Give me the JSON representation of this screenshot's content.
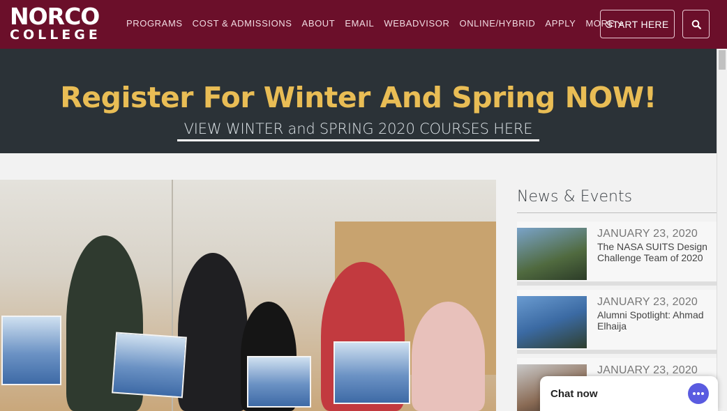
{
  "logo": {
    "line1": "NORCO",
    "line2": "COLLEGE"
  },
  "nav": {
    "items": [
      "PROGRAMS",
      "COST & ADMISSIONS",
      "ABOUT",
      "EMAIL",
      "WEBADVISOR",
      "ONLINE/HYBRID",
      "APPLY"
    ],
    "more_label": "MORE",
    "start_label": "START HERE"
  },
  "banner": {
    "title": "Register For Winter And Spring NOW!",
    "link": "VIEW WINTER and SPRING 2020 COURSES HERE"
  },
  "news": {
    "title": "News & Events",
    "items": [
      {
        "date": "JANUARY 23, 2020",
        "text": "The NASA SUITS Design Challenge Team of 2020"
      },
      {
        "date": "JANUARY 23, 2020",
        "text": "Alumni Spotlight: Ahmad Elhaija"
      },
      {
        "date": "JANUARY 23, 2020",
        "text": ""
      }
    ]
  },
  "chat": {
    "label": "Chat now"
  },
  "colors": {
    "header": "#6b0f2a",
    "banner_bg": "#2b3237",
    "banner_title": "#e9bd55",
    "chat_accent": "#5a5be0"
  },
  "icons": {
    "search": "search-icon",
    "chevron": "chevron-down-icon",
    "chat": "chat-bubble-icon"
  }
}
